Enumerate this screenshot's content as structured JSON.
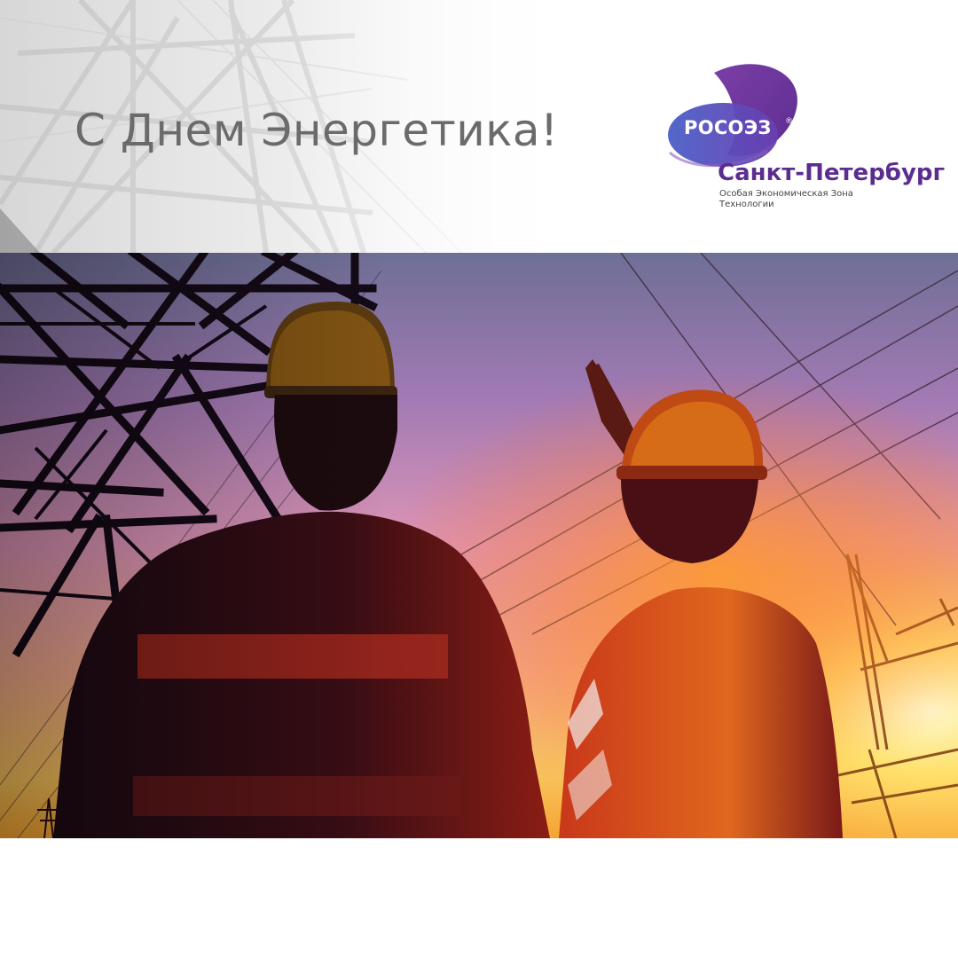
{
  "header": {
    "greeting": "С Днем Энергетика!"
  },
  "logo": {
    "mark": "РОСОЭЗ",
    "registered": "®",
    "city": "Санкт-Петербург",
    "subtitle_line1": "Особая Экономическая Зона",
    "subtitle_line2": "Технологии",
    "colors": {
      "purple": "#5c2d91",
      "violet": "#7b3fa6",
      "blue": "#4a5fc7"
    }
  },
  "photo": {
    "subject": "two-engineers-silhouette",
    "sky_colors": [
      "#6e6f96",
      "#b77dbd",
      "#e8a3b0",
      "#f6c07a",
      "#ffd24a"
    ]
  }
}
